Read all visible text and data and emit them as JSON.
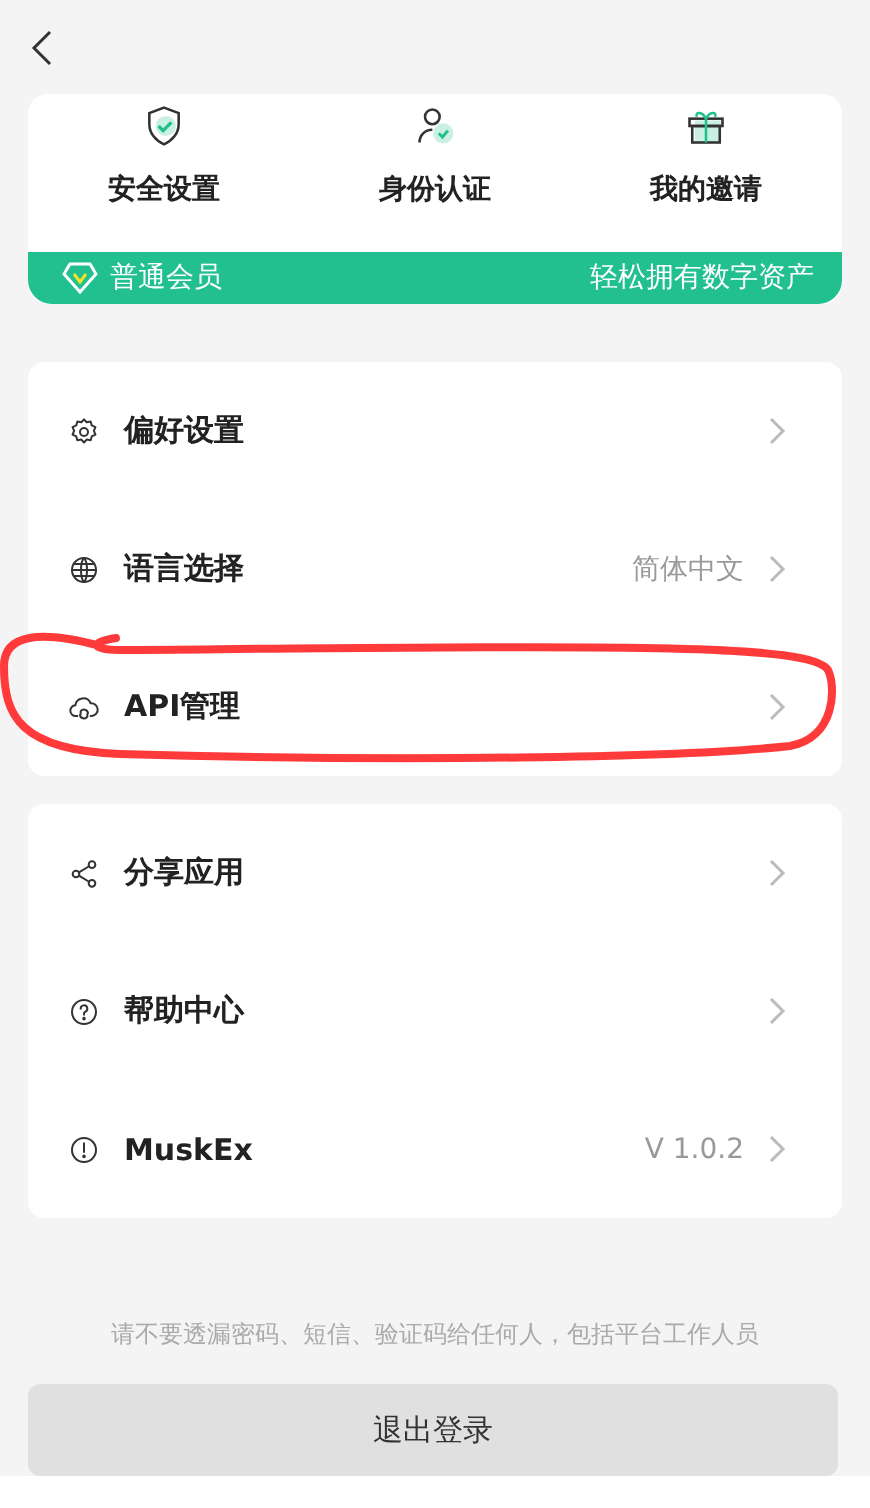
{
  "shortcuts": [
    {
      "kind": "shield",
      "label": "安全设置"
    },
    {
      "kind": "person",
      "label": "身份认证"
    },
    {
      "kind": "gift",
      "label": "我的邀请"
    }
  ],
  "membership": {
    "level": "普通会员",
    "slogan": "轻松拥有数字资产"
  },
  "menu_groups": [
    {
      "items": [
        {
          "kind": "gear",
          "label": "偏好设置",
          "highlighted": false
        },
        {
          "kind": "globe",
          "label": "语言选择",
          "value": "简体中文",
          "highlighted": false
        },
        {
          "kind": "cloud",
          "label": "API管理",
          "highlighted": true
        }
      ]
    },
    {
      "items": [
        {
          "kind": "share",
          "label": "分享应用",
          "highlighted": false
        },
        {
          "kind": "help",
          "label": "帮助中心",
          "highlighted": false
        },
        {
          "kind": "info",
          "label": "MuskEx",
          "value": "V 1.0.2",
          "highlighted": false
        }
      ]
    }
  ],
  "notice": "请不要透漏密码、短信、验证码给任何人，包括平台工作人员",
  "logout_button": "退出登录"
}
